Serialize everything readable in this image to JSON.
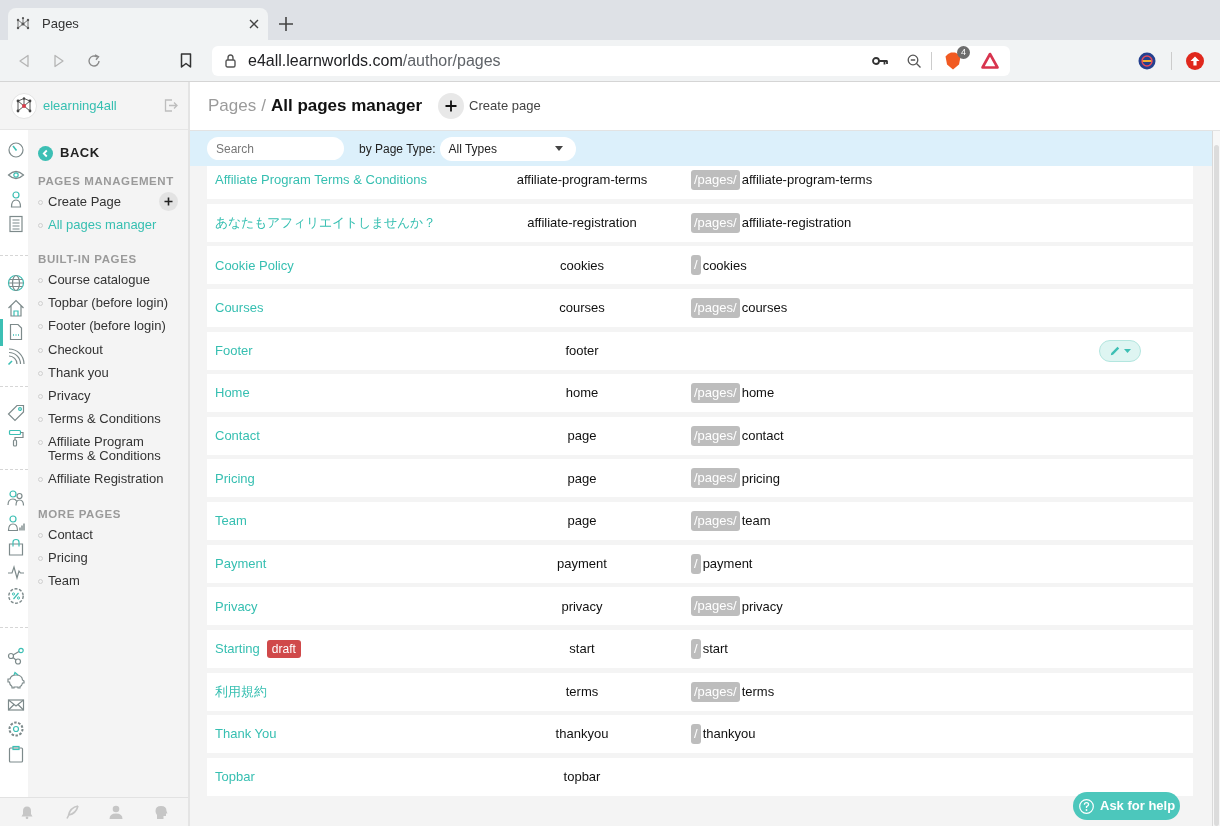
{
  "browser": {
    "tab_title": "Pages",
    "url_host": "e4all.learnworlds.com",
    "url_path": "/author/pages",
    "extension_count": "4"
  },
  "sidebar": {
    "brand": "elearning4all",
    "rail": [
      [
        {
          "selected": false
        },
        {
          "selected": false
        },
        {
          "selected": false
        },
        {
          "selected": false
        }
      ],
      [
        {
          "selected": false
        },
        {
          "selected": false
        },
        {
          "selected": true
        },
        {
          "selected": false
        }
      ],
      [
        {
          "selected": false
        },
        {
          "selected": false
        }
      ],
      [
        {
          "selected": false
        },
        {
          "selected": false
        },
        {
          "selected": false
        },
        {
          "selected": false
        },
        {
          "selected": false
        }
      ],
      [
        {
          "selected": false
        },
        {
          "selected": false
        },
        {
          "selected": false
        },
        {
          "selected": false
        },
        {
          "selected": false
        }
      ]
    ],
    "back": "BACK",
    "sections": [
      {
        "heading": "PAGES MANAGEMENT",
        "items": [
          {
            "label": "Create Page",
            "selected": false,
            "add_button": true
          },
          {
            "label": "All pages manager",
            "selected": true,
            "add_button": false
          }
        ]
      },
      {
        "heading": "BUILT-IN PAGES",
        "items": [
          {
            "label": "Course catalogue",
            "selected": false,
            "add_button": false
          },
          {
            "label": "Topbar (before login)",
            "selected": false,
            "add_button": false
          },
          {
            "label": "Footer (before login)",
            "selected": false,
            "add_button": false
          },
          {
            "label": "Checkout",
            "selected": false,
            "add_button": false
          },
          {
            "label": "Thank you",
            "selected": false,
            "add_button": false
          },
          {
            "label": "Privacy",
            "selected": false,
            "add_button": false
          },
          {
            "label": "Terms & Conditions",
            "selected": false,
            "add_button": false
          },
          {
            "label": "Affiliate Program Terms & Conditions",
            "selected": false,
            "add_button": false
          },
          {
            "label": "Affiliate Registration",
            "selected": false,
            "add_button": false
          }
        ]
      },
      {
        "heading": "MORE PAGES",
        "items": [
          {
            "label": "Contact",
            "selected": false,
            "add_button": false
          },
          {
            "label": "Pricing",
            "selected": false,
            "add_button": false
          },
          {
            "label": "Team",
            "selected": false,
            "add_button": false
          }
        ]
      }
    ]
  },
  "header": {
    "parent": "Pages",
    "separator": "/",
    "title": "All pages manager",
    "create_label": "Create page"
  },
  "filters": {
    "search": {
      "placeholder": "Search"
    },
    "type_label": "by Page Type:",
    "type_value": "All Types"
  },
  "rows": [
    {
      "title": "Affiliate Program Terms & Conditions",
      "slug": "affiliate-program-terms",
      "url_prefix": "/pages/",
      "url_path": "affiliate-program-terms",
      "show_actions": false
    },
    {
      "title": "あなたもアフィリエイトしませんか？",
      "slug": "affiliate-registration",
      "url_prefix": "/pages/",
      "url_path": "affiliate-registration",
      "show_actions": false
    },
    {
      "title": "Cookie Policy",
      "slug": "cookies",
      "url_prefix": "/",
      "url_path": "cookies",
      "show_actions": false
    },
    {
      "title": "Courses",
      "slug": "courses",
      "url_prefix": "/pages/",
      "url_path": "courses",
      "show_actions": false
    },
    {
      "title": "Footer",
      "slug": "footer",
      "show_actions": true
    },
    {
      "title": "Home",
      "slug": "home",
      "url_prefix": "/pages/",
      "url_path": "home",
      "show_actions": false
    },
    {
      "title": "Contact",
      "slug": "page",
      "url_prefix": "/pages/",
      "url_path": "contact",
      "show_actions": false
    },
    {
      "title": "Pricing",
      "slug": "page",
      "url_prefix": "/pages/",
      "url_path": "pricing",
      "show_actions": false
    },
    {
      "title": "Team",
      "slug": "page",
      "url_prefix": "/pages/",
      "url_path": "team",
      "show_actions": false
    },
    {
      "title": "Payment",
      "slug": "payment",
      "url_prefix": "/",
      "url_path": "payment",
      "show_actions": false
    },
    {
      "title": "Privacy",
      "slug": "privacy",
      "url_prefix": "/pages/",
      "url_path": "privacy",
      "show_actions": false
    },
    {
      "title": "Starting",
      "badge": "draft",
      "slug": "start",
      "url_prefix": "/",
      "url_path": "start",
      "show_actions": false
    },
    {
      "title": "利用規約",
      "slug": "terms",
      "url_prefix": "/pages/",
      "url_path": "terms",
      "show_actions": false
    },
    {
      "title": "Thank You",
      "slug": "thankyou",
      "url_prefix": "/",
      "url_path": "thankyou",
      "show_actions": false
    },
    {
      "title": "Topbar",
      "slug": "topbar",
      "show_actions": false
    }
  ],
  "help": {
    "label": "Ask for help"
  }
}
